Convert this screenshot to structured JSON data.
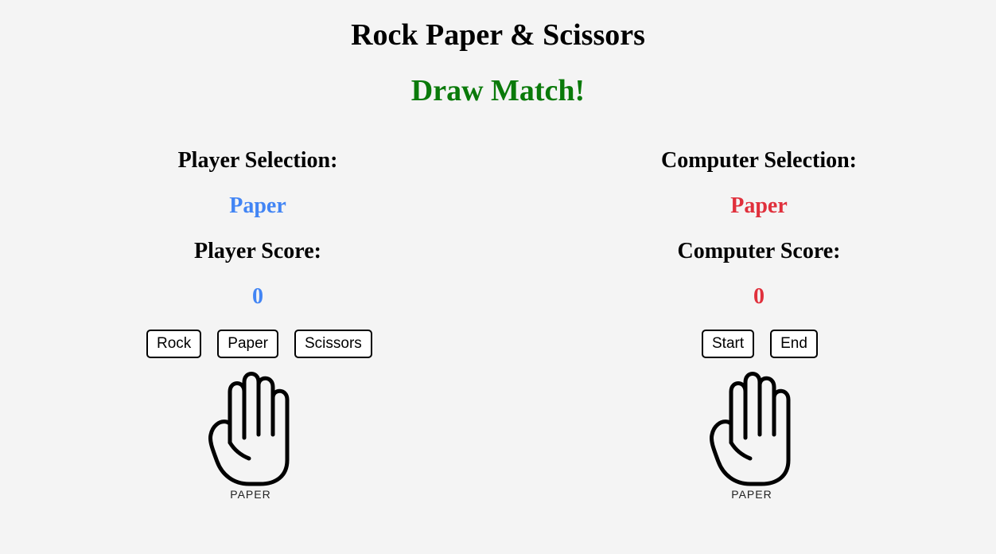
{
  "app": {
    "title": "Rock Paper & Scissors",
    "result": "Draw Match!"
  },
  "colors": {
    "background": "#f4f4f4",
    "result": "#0a7a0a",
    "player": "#4285f4",
    "computer": "#e0303c"
  },
  "player": {
    "selection_label": "Player Selection:",
    "selection_value": "Paper",
    "score_label": "Player Score:",
    "score_value": "0",
    "buttons": {
      "rock": "Rock",
      "paper": "Paper",
      "scissors": "Scissors"
    },
    "hand_icon": "paper-hand-icon",
    "hand_caption": "PAPER"
  },
  "computer": {
    "selection_label": "Computer Selection:",
    "selection_value": "Paper",
    "score_label": "Computer Score:",
    "score_value": "0",
    "buttons": {
      "start": "Start",
      "end": "End"
    },
    "hand_icon": "paper-hand-icon",
    "hand_caption": "PAPER"
  }
}
